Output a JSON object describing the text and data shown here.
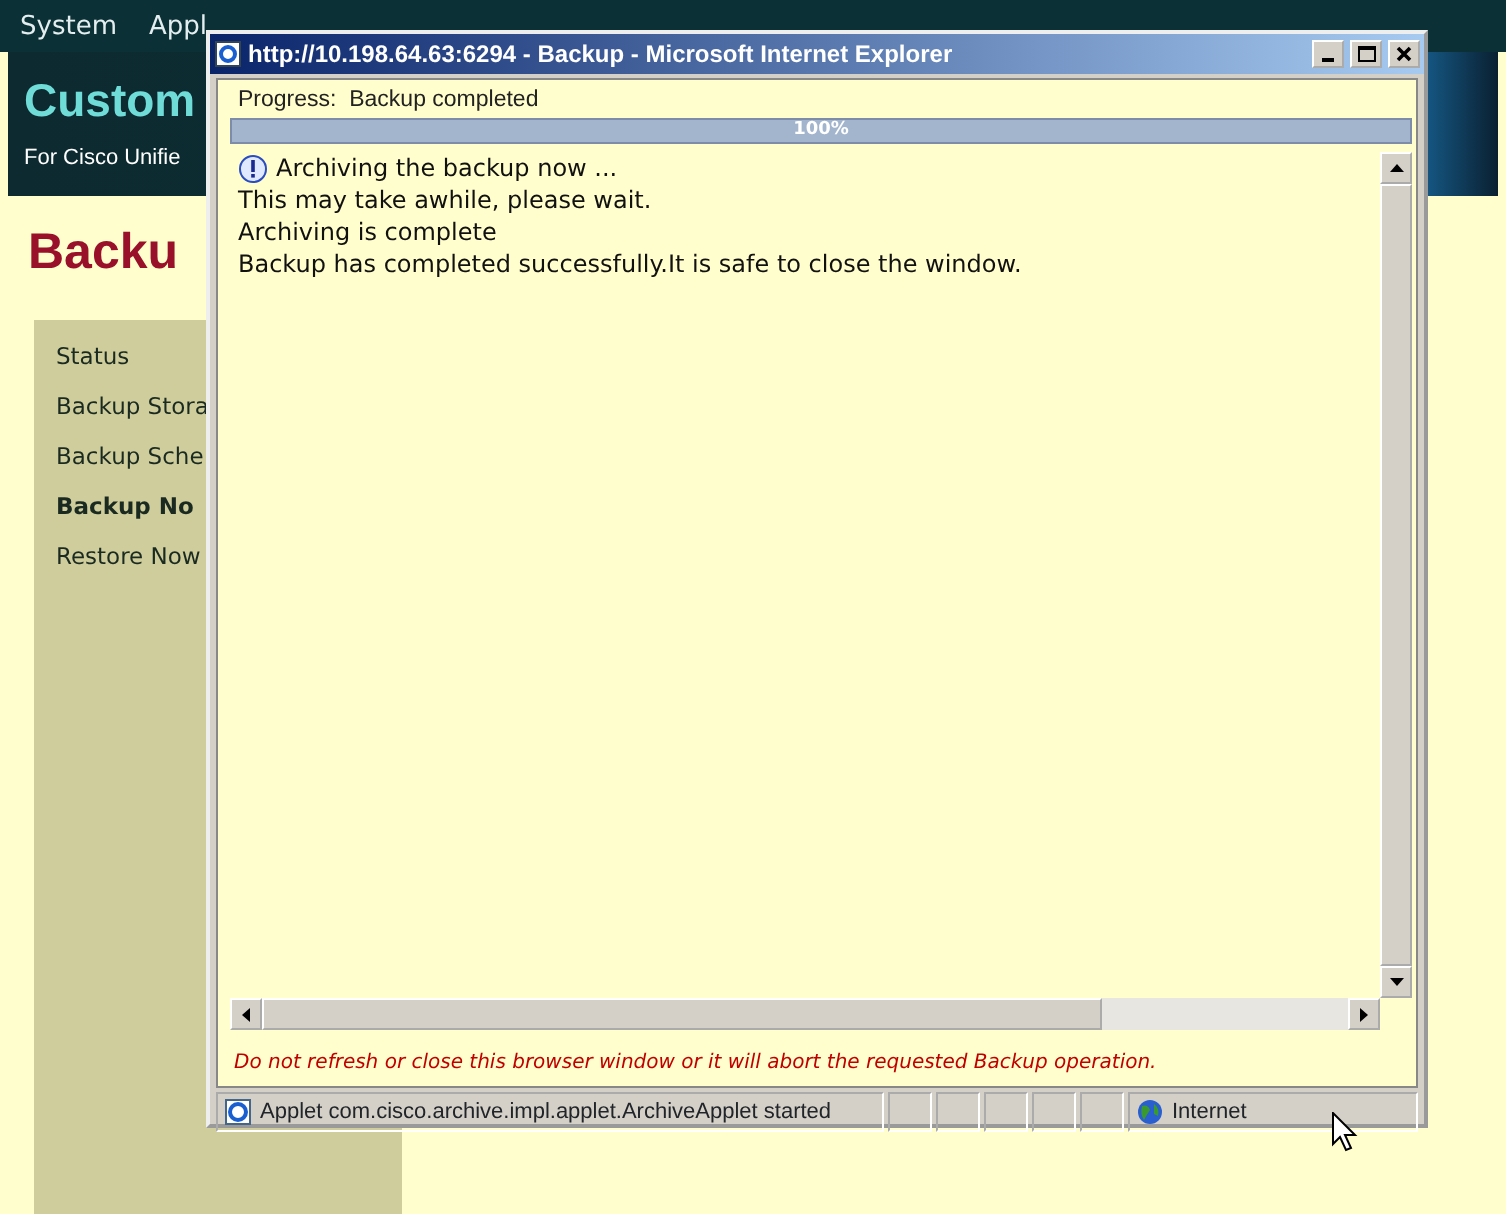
{
  "page": {
    "menu": [
      "System",
      "Appl"
    ],
    "brand_title": "Custom",
    "brand_subtitle": "For Cisco Unifie",
    "heading": "Backu",
    "sidebar": [
      {
        "label": "Status",
        "selected": false
      },
      {
        "label": "Backup Stora",
        "selected": false
      },
      {
        "label": "Backup Sche",
        "selected": false
      },
      {
        "label": "Backup No",
        "selected": true
      },
      {
        "label": "Restore Now",
        "selected": false
      }
    ]
  },
  "popup": {
    "title": "http://10.198.64.63:6294 - Backup - Microsoft Internet Explorer",
    "progress_label": "Progress:  Backup completed",
    "progress": {
      "level": 1,
      "reading": "100%"
    },
    "log": [
      {
        "kind": "info",
        "text": "Archiving the backup now ..."
      },
      {
        "kind": "plain",
        "text": "This may take awhile, please wait."
      },
      {
        "kind": "plain",
        "text": "Archiving is complete"
      },
      {
        "kind": "plain",
        "text": "Backup has completed successfully.It is safe to close the window."
      }
    ],
    "warning": "Do not refresh or close this browser window or it will abort the requested Backup operation.",
    "status_bar": {
      "text": "Applet com.cisco.archive.impl.applet.ArchiveApplet started",
      "zone": "Internet"
    }
  }
}
